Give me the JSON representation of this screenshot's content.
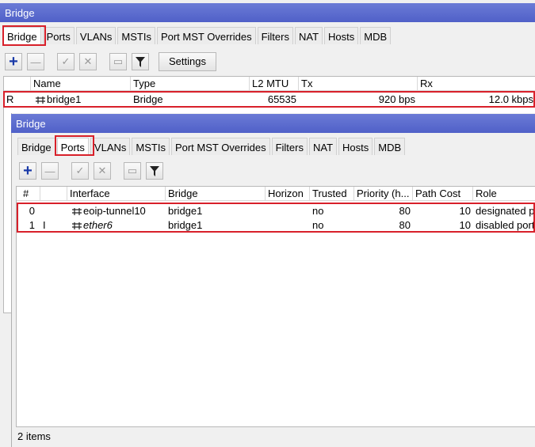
{
  "main": {
    "title": "Bridge",
    "tabs": [
      "Bridge",
      "Ports",
      "VLANs",
      "MSTIs",
      "Port MST Overrides",
      "Filters",
      "NAT",
      "Hosts",
      "MDB"
    ],
    "settings_label": "Settings",
    "columns": [
      "Name",
      "Type",
      "L2 MTU",
      "Tx",
      "Rx"
    ],
    "rows": [
      {
        "flag": "R",
        "name": "bridge1",
        "type": "Bridge",
        "mtu": "65535",
        "tx": "920 bps",
        "rx": "12.0 kbps"
      }
    ]
  },
  "ports": {
    "title": "Bridge",
    "tabs": [
      "Bridge",
      "Ports",
      "VLANs",
      "MSTIs",
      "Port MST Overrides",
      "Filters",
      "NAT",
      "Hosts",
      "MDB"
    ],
    "columns": [
      "#",
      "Interface",
      "Bridge",
      "Horizon",
      "Trusted",
      "Priority (h...",
      "Path Cost",
      "Role"
    ],
    "rows": [
      {
        "num": "0",
        "flag": "",
        "iface": "eoip-tunnel10",
        "bridge": "bridge1",
        "horizon": "",
        "trusted": "no",
        "priority": "80",
        "cost": "10",
        "role": "designated p"
      },
      {
        "num": "1",
        "flag": "I",
        "iface": "ether6",
        "bridge": "bridge1",
        "horizon": "",
        "trusted": "no",
        "priority": "80",
        "cost": "10",
        "role": "disabled port"
      }
    ],
    "status": "2 items"
  },
  "colors": {
    "highlight": "#d8202a",
    "titlebar": "#5a6ad0"
  }
}
